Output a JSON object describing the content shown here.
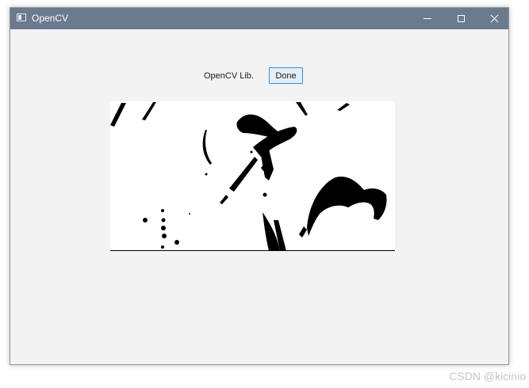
{
  "window": {
    "title": "OpenCV",
    "app_icon": "app-window-icon",
    "controls": {
      "minimize_icon": "minimize-icon",
      "maximize_icon": "maximize-icon",
      "close_icon": "close-icon"
    },
    "titlebar_color": "#6b7a8d",
    "background_color": "#f3f3f4"
  },
  "content": {
    "label": "OpenCV Lib.",
    "done_button": "Done",
    "image": "binary-thresholded-image"
  },
  "watermark": "CSDN @kicinio"
}
